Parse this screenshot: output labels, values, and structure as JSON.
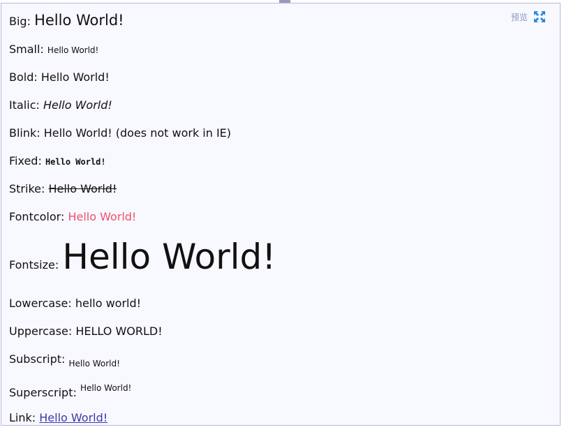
{
  "toolbar": {
    "preview_label": "预览",
    "fullscreen_icon": "fullscreen-icon",
    "accent": "#2a8ad8"
  },
  "rows": {
    "big": {
      "label": "Big: ",
      "value": "Hello World!"
    },
    "small": {
      "label": "Small: ",
      "value": "Hello World!"
    },
    "bold": {
      "label": "Bold: ",
      "value": "Hello World!"
    },
    "italic": {
      "label": "Italic: ",
      "value": "Hello World!"
    },
    "blink": {
      "label": "Blink: ",
      "value": "Hello World! (does not work in IE)"
    },
    "fixed": {
      "label": "Fixed: ",
      "value": "Hello World!"
    },
    "strike": {
      "label": "Strike: ",
      "value": "Hello World!"
    },
    "fontcolor": {
      "label": "Fontcolor: ",
      "value": "Hello World!"
    },
    "fontsize": {
      "label": "Fontsize: ",
      "value": "Hello World!"
    },
    "lowercase": {
      "label": "Lowercase: ",
      "value": "hello world!"
    },
    "uppercase": {
      "label": "Uppercase: ",
      "value": "HELLO WORLD!"
    },
    "subscript": {
      "label": "Subscript: ",
      "value": "Hello World!"
    },
    "superscript": {
      "label": "Superscript: ",
      "value": "Hello World!"
    },
    "link": {
      "label": "Link: ",
      "value": "Hello World!"
    }
  },
  "colors": {
    "fontcolor_red": "#f0506a",
    "link_blue": "#3a3aa8",
    "panel_border": "#b8b8e0",
    "panel_bg": "#f8f8ff"
  }
}
